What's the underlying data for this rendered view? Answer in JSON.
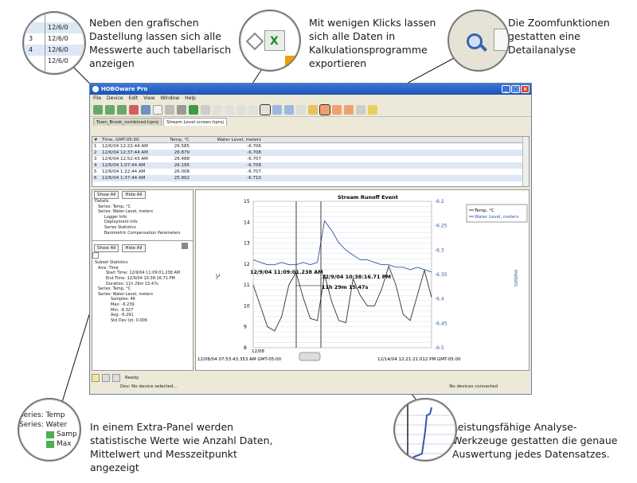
{
  "callouts": {
    "top_left": "Neben den grafischen Dastellung lassen sich alle Messwerte auch tabellarisch anzeigen",
    "top_mid": "Mit wenigen Klicks lassen sich alle Daten in Kalkulationsprogramme exportieren",
    "top_right": "Die Zoomfunktionen gestatten eine Detailanalyse",
    "bottom_left": "In einem Extra-Panel werden statistische Werte wie Anzahl Daten, Mittelwert und Messzeitpunkt angezeigt",
    "bottom_right": "Leistungsfähige Analyse-Werkzeuge gestatten die genaue Auswertung jedes Datensatzes."
  },
  "zoom_left": {
    "rows": [
      [
        "",
        "12/6/0"
      ],
      [
        "3",
        "12/6/0"
      ],
      [
        "4",
        "12/6/0"
      ],
      [
        "",
        "12/6/0"
      ]
    ]
  },
  "zoom_bl": {
    "lines": [
      "Series: Temp",
      "Series: Water",
      "Samp",
      "Max"
    ]
  },
  "window": {
    "title": "HOBOware Pro",
    "menu": [
      "File",
      "Device",
      "Edit",
      "View",
      "Window",
      "Help"
    ],
    "tabs": [
      "Town_Brook_combined.hproj",
      "Stream Level screen.hproj"
    ],
    "table": {
      "headers": [
        "#",
        "Time, GMT-05:00",
        "Temp, °C",
        "Water Level, meters"
      ],
      "rows": [
        [
          "1",
          "12/6/04 12:22:44 AM",
          "26.585",
          "-6.706"
        ],
        [
          "2",
          "12/6/04 12:37:44 AM",
          "26.879",
          "-6.708"
        ],
        [
          "3",
          "12/6/04 12:52:43 AM",
          "26.488",
          "-6.707"
        ],
        [
          "4",
          "12/6/04 1:07:44 AM",
          "26.195",
          "-6.708"
        ],
        [
          "5",
          "12/6/04 1:22:44 AM",
          "26.008",
          "-6.707"
        ],
        [
          "6",
          "12/6/04 1:37:44 AM",
          "25.902",
          "-6.710"
        ]
      ]
    },
    "details": {
      "show_all": "Show All",
      "hide_all": "Hide All",
      "title": "Details",
      "items": [
        "Series: Temp, °C",
        "Series: Water Level, meters",
        "Logger Info",
        "Deployment Info",
        "Series Statistics",
        "Barometric Compensation Parameters"
      ]
    },
    "stats": {
      "title": "Subset Statistics",
      "lines": [
        "Axis: Time",
        "Start Time: 12/9/04 11:09:01.238 AM",
        "End Time: 12/9/04 10:38:16.71 PM",
        "Duration: 11h 29m 15.47s",
        "Series: Temp, °C",
        "Series: Water Level, meters",
        "Samples: 46",
        "Max: -6.239",
        "Min: -6.327",
        "Avg: -6.291",
        "Std Dev (σ): 0.006"
      ]
    },
    "status": {
      "ready": "Ready.",
      "device": "Dev: No device selected...",
      "connected": "No devices connected"
    }
  },
  "chart_data": {
    "type": "line",
    "title": "Stream Runoff Event",
    "ylabel": "°C",
    "y2label": "meters",
    "ylim": [
      8,
      15
    ],
    "y2lim": [
      -6.5,
      -6.2
    ],
    "yticks": [
      "15",
      "14",
      "13",
      "12",
      "11",
      "10",
      "9",
      "8"
    ],
    "y2ticks": [
      "-6.2",
      "-6.25",
      "-6.3",
      "-6.35",
      "-6.4",
      "-6.45",
      "-6.5"
    ],
    "x_start_label": "12/08/04 07:53:43.353 AM GMT-05:00",
    "x_end_label": "12/14/04 12:21:21.012 PM GMT-05:00",
    "x_first_tick": "12/08",
    "markers": [
      "12/9/04 11:09:01.238 AM",
      "12/9/04 10:38:16.71 PM"
    ],
    "duration_label": "11h 29m 15.47s",
    "legend": [
      "Temp, °C",
      "Water Level, meters"
    ],
    "series": [
      {
        "name": "Temp, °C",
        "color": "#333333",
        "values": [
          11.0,
          10.0,
          9.0,
          8.8,
          9.5,
          11.0,
          11.6,
          10.4,
          9.4,
          9.3,
          11.5,
          10.2,
          9.3,
          9.2,
          11.3,
          10.5,
          10.0,
          10.0,
          10.8,
          11.9,
          11.0,
          9.6,
          9.3,
          10.5,
          11.7,
          10.4
        ]
      },
      {
        "name": "Water Level, meters",
        "color": "#3355aa",
        "values": [
          -6.32,
          -6.325,
          -6.33,
          -6.33,
          -6.325,
          -6.33,
          -6.33,
          -6.325,
          -6.33,
          -6.325,
          -6.24,
          -6.26,
          -6.285,
          -6.3,
          -6.31,
          -6.32,
          -6.32,
          -6.325,
          -6.33,
          -6.33,
          -6.335,
          -6.335,
          -6.34,
          -6.335,
          -6.34,
          -6.345
        ]
      }
    ]
  }
}
